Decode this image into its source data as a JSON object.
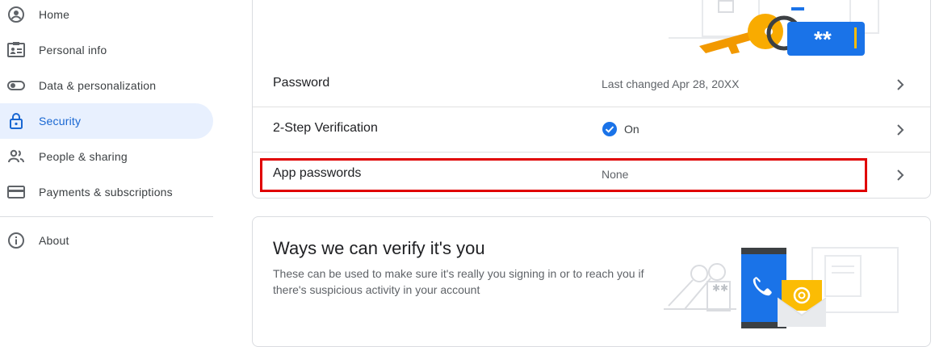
{
  "sidebar": {
    "items": [
      {
        "label": "Home",
        "icon": "account-circle-icon"
      },
      {
        "label": "Personal info",
        "icon": "id-card-icon"
      },
      {
        "label": "Data & personalization",
        "icon": "toggle-icon"
      },
      {
        "label": "Security",
        "icon": "lock-icon",
        "active": true
      },
      {
        "label": "People & sharing",
        "icon": "people-icon"
      },
      {
        "label": "Payments & subscriptions",
        "icon": "credit-card-icon"
      }
    ],
    "about": {
      "label": "About",
      "icon": "info-icon"
    }
  },
  "security_card": {
    "rows": [
      {
        "label": "Password",
        "value": "Last changed Apr 28, 20XX"
      },
      {
        "label": "2-Step Verification",
        "value": "On",
        "status_icon": "check-circle-icon"
      },
      {
        "label": "App passwords",
        "value": "None"
      }
    ],
    "illustration_text": "**"
  },
  "verify_card": {
    "title": "Ways we can verify it's you",
    "description": "These can be used to make sure it's really you signing in or to reach you if there's suspicious activity in your account"
  },
  "colors": {
    "accent": "#1a73e8",
    "active_bg": "#e8f0fe",
    "highlight": "#e00000",
    "key_yellow": "#f9ab00"
  }
}
